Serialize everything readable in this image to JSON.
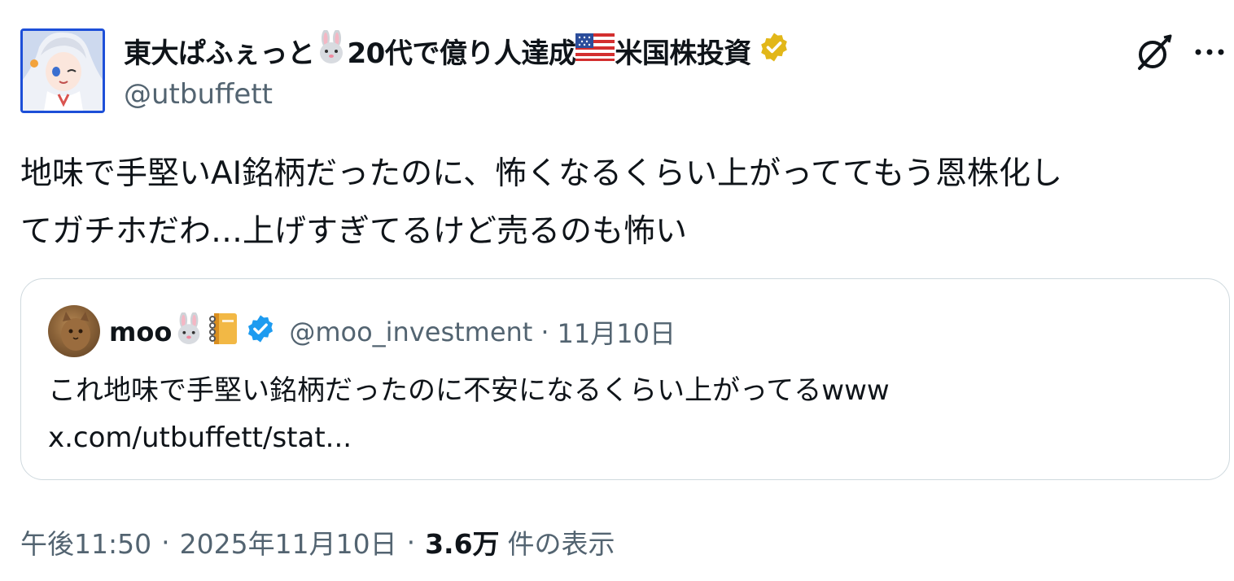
{
  "author": {
    "name_part1": "東大ぱふぇっと",
    "name_part2": "20代で億り人達成",
    "name_part3": "米国株投資",
    "handle": "@utbuffett",
    "name_emojis": [
      "rabbit-emoji",
      "us-flag-emoji"
    ],
    "verified_badge": "gold-verified-badge-icon",
    "colors": {
      "badge": "#e2b719",
      "avatar_border": "#1d4fd8"
    }
  },
  "actions": {
    "grok_icon": "grok-icon",
    "more_icon": "more-icon"
  },
  "tweet": {
    "lines": [
      "地味で手堅いAI銘柄だったのに、怖くなるくらい上がっててもう恩株化し",
      "てガチホだわ…上げすぎてるけど売るのも怖い"
    ]
  },
  "quote": {
    "name": "moo",
    "name_emojis": [
      "rabbit-emoji",
      "notebook-emoji"
    ],
    "verified_badge": "blue-verified-badge-icon",
    "handle": "@moo_investment",
    "dot": "·",
    "date": "11月10日",
    "text": "これ地味で手堅い銘柄だったのに不安になるくらい上がってるwww",
    "link": "x.com/utbuffett/stat...",
    "colors": {
      "badge": "#1d9bf0",
      "border": "#cfd9de"
    }
  },
  "meta": {
    "time": "午後11:50",
    "sep": "·",
    "date": "2025年11月10日",
    "views_count": "3.6万",
    "views_label": "件の表示"
  }
}
